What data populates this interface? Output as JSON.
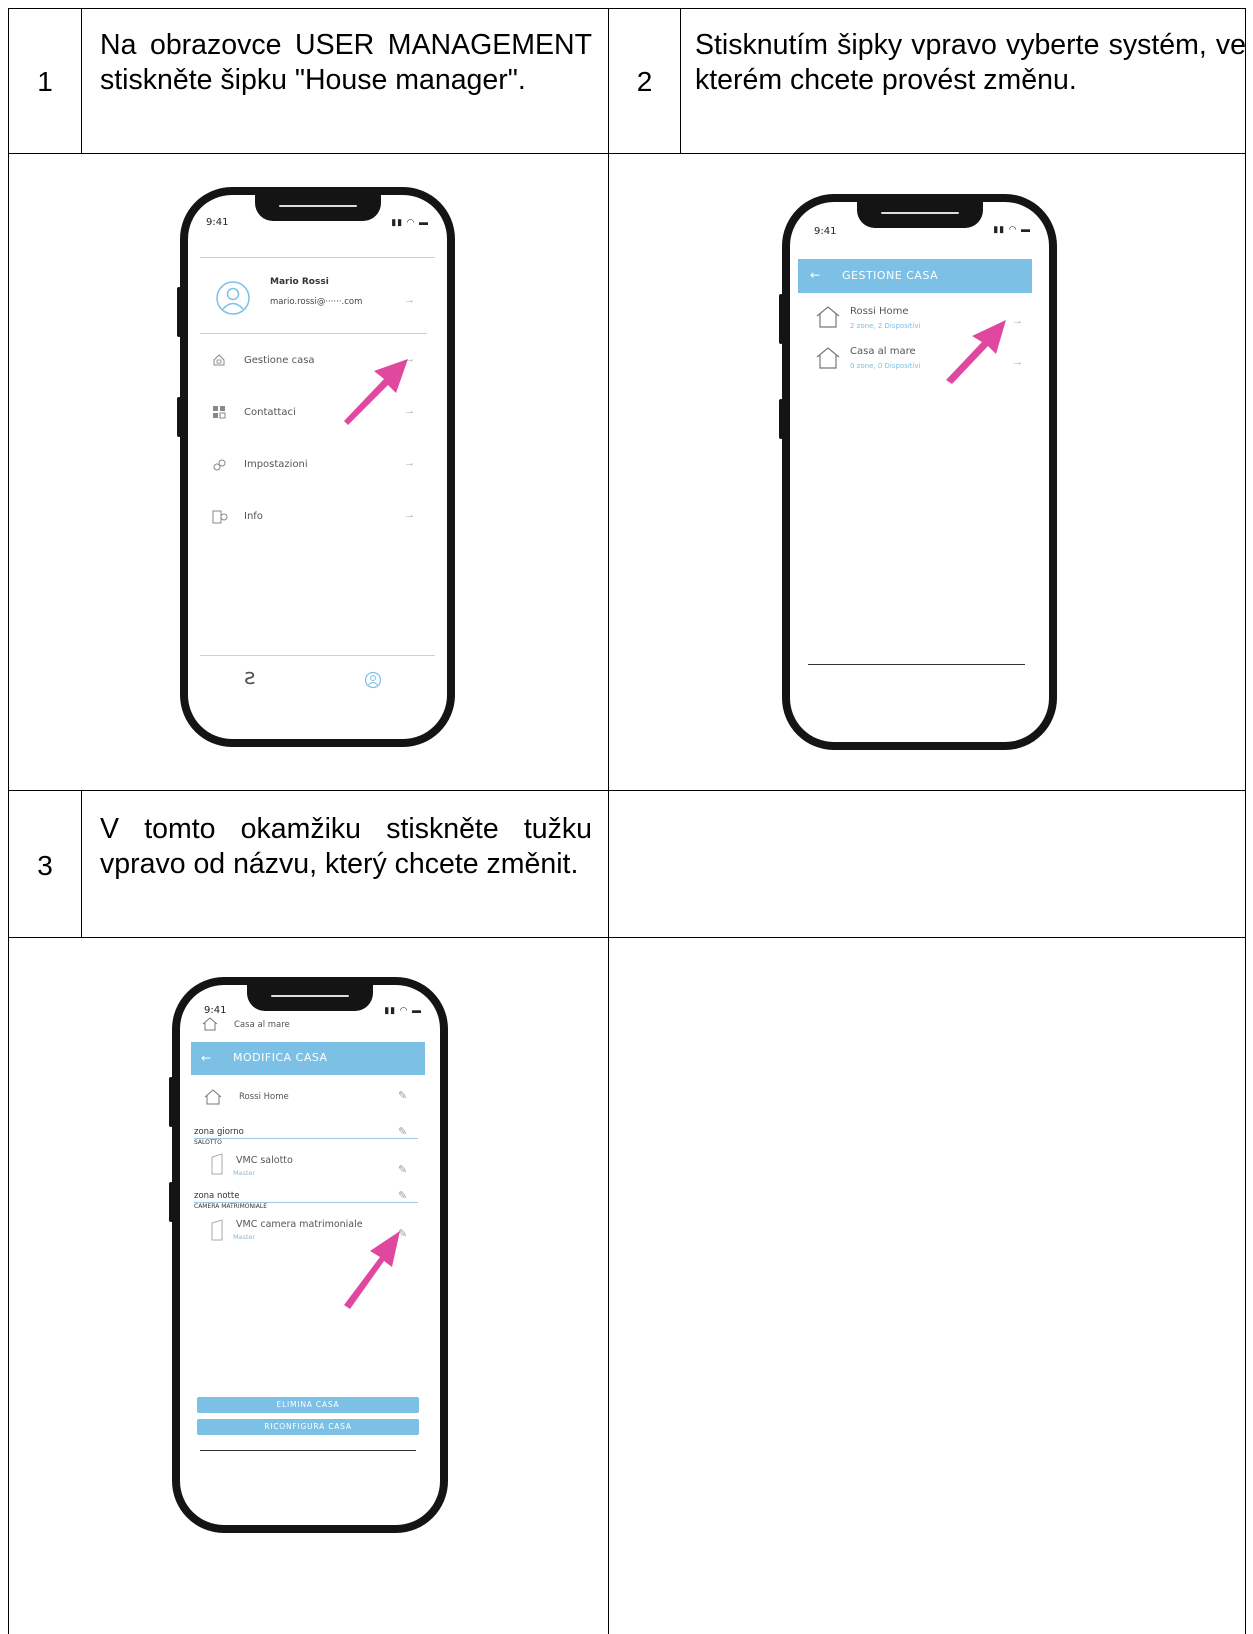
{
  "steps": [
    {
      "number": "1",
      "text": "Na obrazovce USER MANAGEMENT stiskněte šipku \"House manager\"."
    },
    {
      "number": "2",
      "text": "Stisknutím šipky vpravo vyberte systém, ve kterém chcete provést změnu."
    },
    {
      "number": "3",
      "text": "V tomto okamžiku stiskněte tužku vpravo od názvu, který chcete změnit."
    }
  ],
  "phone1": {
    "time": "9:41",
    "user_name": "Mario Rossi",
    "user_email": "mario.rossi@······.com",
    "menu": [
      "Gestione casa",
      "Contattaci",
      "Impostazioni",
      "Info"
    ],
    "arrow": "→"
  },
  "phone2": {
    "time": "9:41",
    "title": "GESTIONE CASA",
    "homes": [
      {
        "name": "Rossi Home",
        "detail": "2 zone, 2 Dispositivi"
      },
      {
        "name": "Casa al mare",
        "detail": "0 zone, 0 Dispositivi"
      }
    ],
    "arrow": "→"
  },
  "phone3": {
    "time": "9:41",
    "top_home": "Casa al mare",
    "title": "MODIFICA CASA",
    "home_name": "Rossi Home",
    "zone1": "zona giorno",
    "room1": "SALOTTO",
    "device1": "VMC salotto",
    "device1_role": "Master",
    "zone2": "zona notte",
    "room2": "CAMERA MATRIMONIALE",
    "device2": "VMC camera matrimoniale",
    "device2_role": "Master",
    "btn_delete": "ELIMINA CASA",
    "btn_reconf": "RICONFIGURA CASA"
  },
  "colors": {
    "accent_blue": "#7cc0e6",
    "highlight_arrow": "#e0479e",
    "phone_body": "#141414"
  }
}
